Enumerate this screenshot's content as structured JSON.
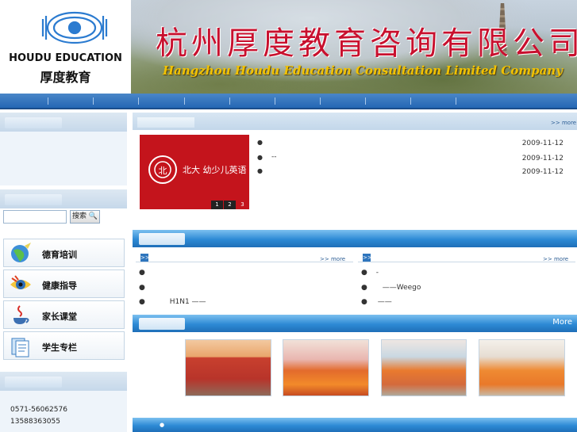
{
  "header": {
    "logo_en": "HOUDU EDUCATION",
    "logo_cn": "厚度教育",
    "title_cn": "杭州厚度教育咨询有限公司",
    "title_en": "Hangzhou Houdu Education Consultation Limited Company"
  },
  "sidebar": {
    "search_button": "搜索",
    "links": [
      {
        "label": "德育培训",
        "icon": "globe-icon"
      },
      {
        "label": "健康指导",
        "icon": "eye-icon"
      },
      {
        "label": "家长课堂",
        "icon": "java-cup-icon"
      },
      {
        "label": "学生专栏",
        "icon": "documents-icon"
      }
    ],
    "contact": {
      "phone1": "0571-56062576",
      "phone2": "13588363055"
    }
  },
  "news": {
    "more": "more",
    "feature_image_text": "北大 幼少儿英语",
    "pager": [
      "1",
      "2",
      "3"
    ],
    "items": [
      {
        "text": "",
        "date": "2009-11-12"
      },
      {
        "text": "--",
        "date": "2009-11-12"
      },
      {
        "text": "",
        "date": "2009-11-12"
      }
    ]
  },
  "left_column": {
    "more": "more",
    "items": [
      "",
      "",
      "H1N1 ——"
    ]
  },
  "right_column": {
    "more": "more",
    "items": [
      "-",
      "——Weego",
      "——"
    ]
  },
  "gallery": {
    "more": "More",
    "photos": [
      "photo-storefront",
      "photo-clown-party",
      "photo-kids-gathering",
      "photo-classroom"
    ]
  },
  "colors": {
    "brand_red": "#c8102e",
    "nav_blue": "#2467b4",
    "accent_gold": "#f2c200"
  }
}
